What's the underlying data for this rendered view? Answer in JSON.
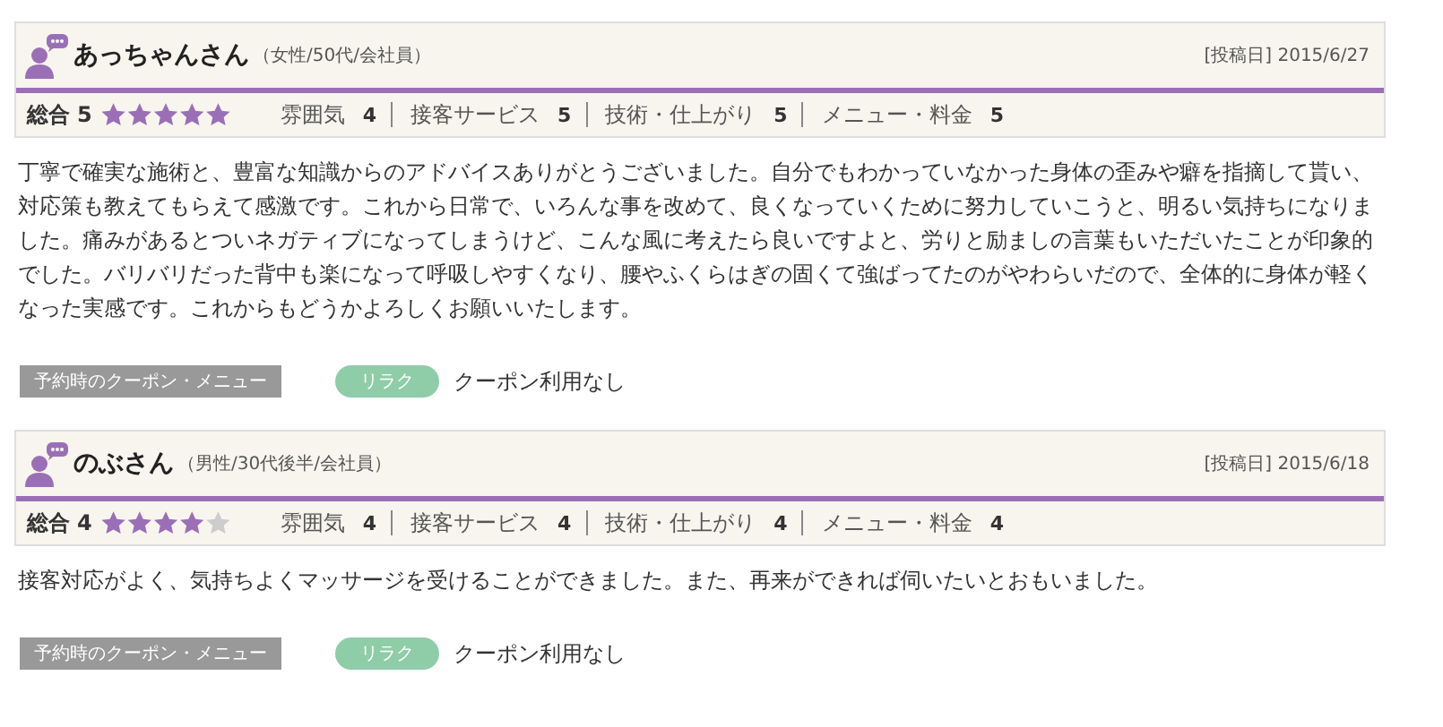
{
  "reviews": [
    {
      "name": "あっちゃんさん",
      "profile": "（女性/50代/会社員）",
      "date": "[投稿日] 2015/6/27",
      "overall_label": "総合",
      "overall": "5",
      "stars": 5,
      "ratings": [
        {
          "label": "雰囲気",
          "value": "4"
        },
        {
          "label": "接客サービス",
          "value": "5"
        },
        {
          "label": "技術・仕上がり",
          "value": "5"
        },
        {
          "label": "メニュー・料金",
          "value": "5"
        }
      ],
      "body": "丁寧で確実な施術と、豊富な知識からのアドバイスありがとうございました。自分でもわかっていなかった身体の歪みや癖を指摘して貰い、対応策も教えてもらえて感激です。これから日常で、いろんな事を改めて、良くなっていくために努力していこうと、明るい気持ちになりました。痛みがあるとついネガティブになってしまうけど、こんな風に考えたら良いですよと、労りと励ましの言葉もいただいたことが印象的でした。バリバリだった背中も楽になって呼吸しやすくなり、腰やふくらはぎの固くて強ばってたのがやわらいだので、全体的に身体が軽くなった実感です。これからもどうかよろしくお願いいたします。",
      "coupon_label": "予約時のクーポン・メニュー",
      "tag": "リラク",
      "coupon": "クーポン利用なし"
    },
    {
      "name": "のぶさん",
      "profile": "（男性/30代後半/会社員）",
      "date": "[投稿日] 2015/6/18",
      "overall_label": "総合",
      "overall": "4",
      "stars": 4,
      "ratings": [
        {
          "label": "雰囲気",
          "value": "4"
        },
        {
          "label": "接客サービス",
          "value": "4"
        },
        {
          "label": "技術・仕上がり",
          "value": "4"
        },
        {
          "label": "メニュー・料金",
          "value": "4"
        }
      ],
      "body": "接客対応がよく、気持ちよくマッサージを受けることができました。また、再来ができれば伺いたいとおもいました。",
      "coupon_label": "予約時のクーポン・メニュー",
      "tag": "リラク",
      "coupon": "クーポン利用なし"
    }
  ]
}
